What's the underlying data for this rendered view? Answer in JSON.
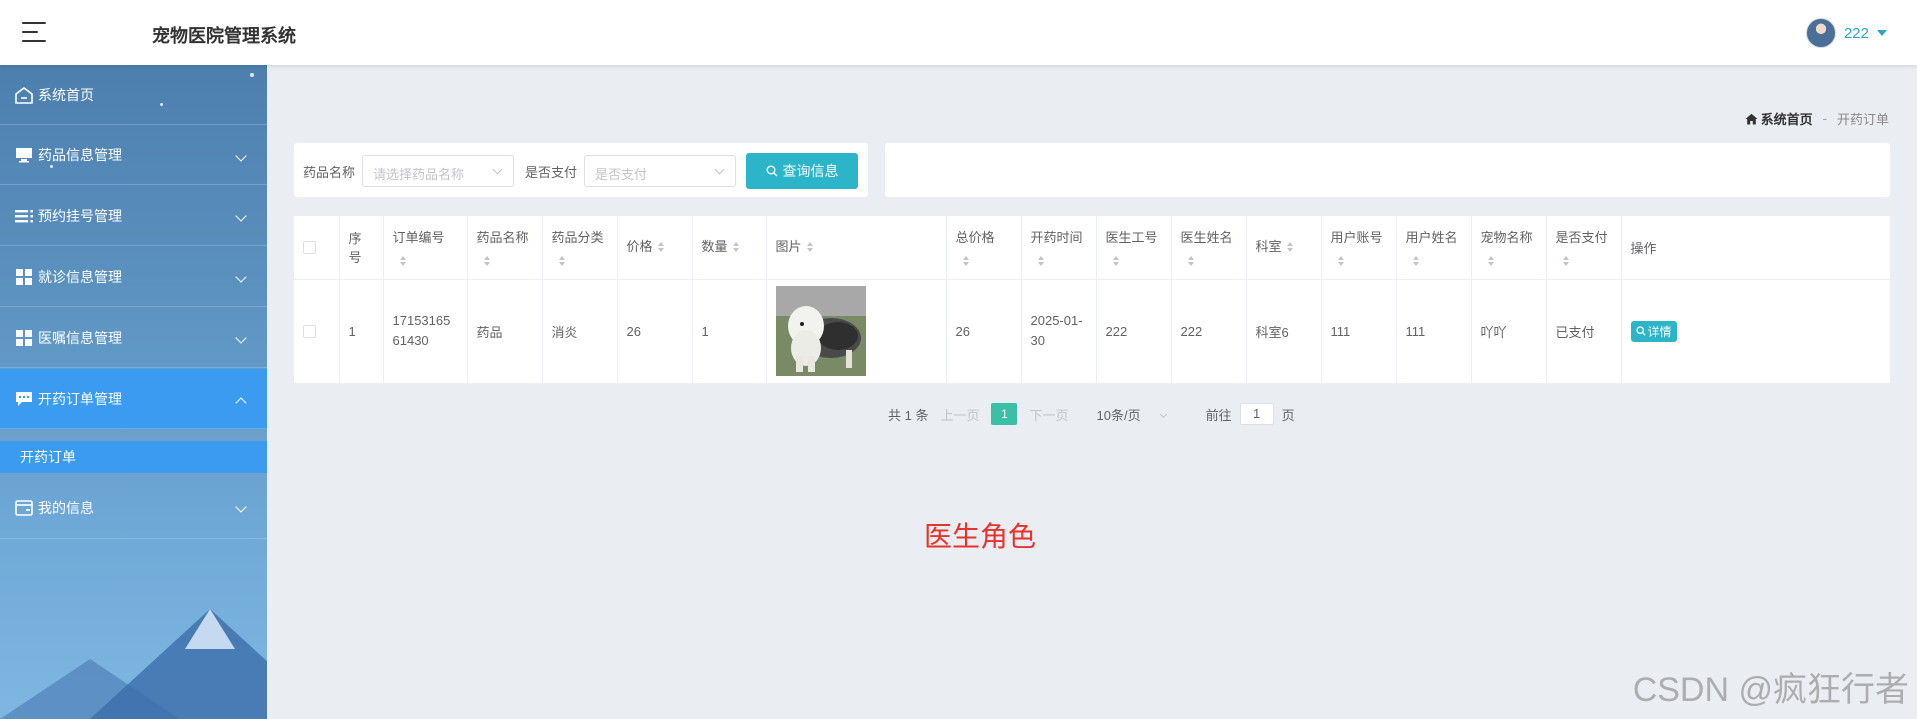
{
  "header": {
    "title": "宠物医院管理系统",
    "user_name": "222"
  },
  "sidebar": {
    "items": [
      {
        "label": "系统首页",
        "icon": "home-icon"
      },
      {
        "label": "药品信息管理",
        "icon": "monitor-icon"
      },
      {
        "label": "预约挂号管理",
        "icon": "list-icon"
      },
      {
        "label": "就诊信息管理",
        "icon": "grid-icon"
      },
      {
        "label": "医嘱信息管理",
        "icon": "grid-icon"
      },
      {
        "label": "开药订单管理",
        "icon": "chat-icon"
      },
      {
        "label": "我的信息",
        "icon": "card-icon"
      }
    ],
    "sub_item": "开药订单"
  },
  "breadcrumb": {
    "home": "系统首页",
    "separator": "-",
    "current": "开药订单"
  },
  "search": {
    "drug_label": "药品名称",
    "drug_placeholder": "请选择药品名称",
    "paid_label": "是否支付",
    "paid_placeholder": "是否支付",
    "button_label": "查询信息"
  },
  "table": {
    "headers": {
      "index": "序号",
      "order_no": "订单编号",
      "drug_name": "药品名称",
      "drug_category": "药品分类",
      "price": "价格",
      "quantity": "数量",
      "image": "图片",
      "total": "总价格",
      "time": "开药时间",
      "doctor_id": "医生工号",
      "doctor_name": "医生姓名",
      "department": "科室",
      "user_account": "用户账号",
      "user_name": "用户姓名",
      "pet_name": "宠物名称",
      "paid": "是否支付",
      "action": "操作"
    },
    "rows": [
      {
        "index": "1",
        "order_no": "1715316561430",
        "drug_name": "药品",
        "drug_category": "消炎",
        "price": "26",
        "quantity": "1",
        "total": "26",
        "time": "2025-01-30",
        "doctor_id": "222",
        "doctor_name": "222",
        "department": "科室6",
        "user_account": "111",
        "user_name": "111",
        "pet_name": "吖吖",
        "paid": "已支付",
        "action_label": "详情"
      }
    ]
  },
  "pagination": {
    "total": "共 1 条",
    "prev": "上一页",
    "current": "1",
    "next": "下一页",
    "page_size": "10条/页",
    "goto_prefix": "前往",
    "goto_value": "1",
    "goto_suffix": "页"
  },
  "annotation": "医生角色",
  "watermark": "CSDN @疯狂行者",
  "colors": {
    "accent": "#2cb4c8",
    "sidebar_active": "#3a9bf0",
    "pager_active": "#3bc0a8",
    "annotation": "#e8332c"
  }
}
